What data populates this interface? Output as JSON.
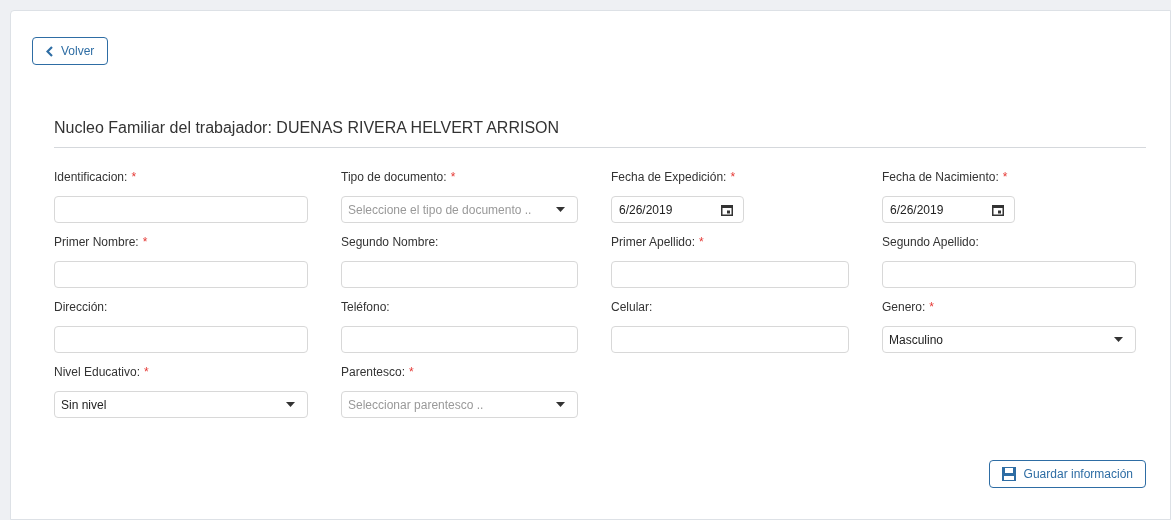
{
  "back_button": {
    "label": "Volver"
  },
  "title": "Nucleo Familiar del trabajador: DUENAS RIVERA HELVERT ARRISON",
  "fields": [
    {
      "kind": "text",
      "label": "Identificacion:",
      "required": true
    },
    {
      "kind": "select",
      "label": "Tipo de documento:",
      "required": true,
      "placeholder": "Seleccione el tipo de documento .."
    },
    {
      "kind": "date",
      "label": "Fecha de Expedición:",
      "required": true,
      "value": "6/26/2019"
    },
    {
      "kind": "date",
      "label": "Fecha de Nacimiento:",
      "required": true,
      "value": "6/26/2019"
    },
    {
      "kind": "text",
      "label": "Primer Nombre:",
      "required": true
    },
    {
      "kind": "text",
      "label": "Segundo Nombre:",
      "required": false
    },
    {
      "kind": "text",
      "label": "Primer Apellido:",
      "required": true
    },
    {
      "kind": "text",
      "label": "Segundo Apellido:",
      "required": false
    },
    {
      "kind": "text",
      "label": "Dirección:",
      "required": false
    },
    {
      "kind": "text",
      "label": "Teléfono:",
      "required": false
    },
    {
      "kind": "text",
      "label": "Celular:",
      "required": false
    },
    {
      "kind": "select",
      "label": "Genero:",
      "required": true,
      "value": "Masculino"
    },
    {
      "kind": "select",
      "label": "Nivel Educativo:",
      "required": true,
      "value": "Sin nivel"
    },
    {
      "kind": "select",
      "label": "Parentesco:",
      "required": true,
      "placeholder": "Seleccionar parentesco .."
    }
  ],
  "required_mark": "*",
  "save_button": {
    "label": "Guardar información"
  }
}
